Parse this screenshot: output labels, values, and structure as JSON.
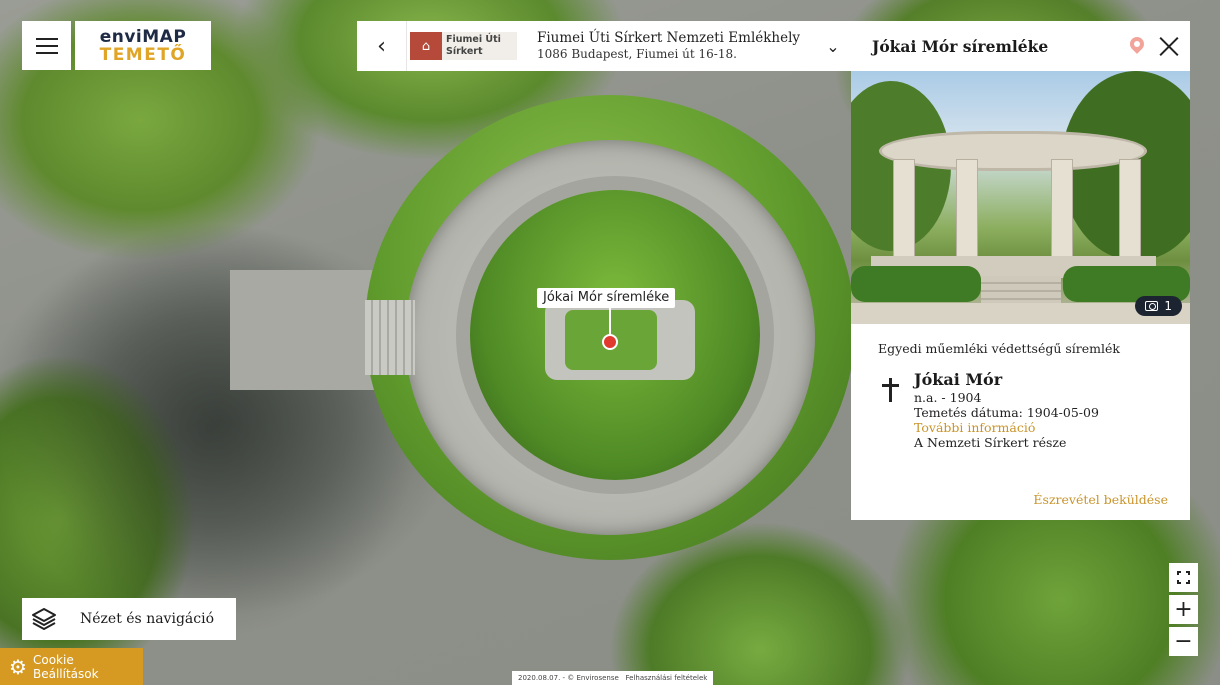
{
  "app": {
    "logo_top": "enviMAP",
    "logo_bottom": "TEMETŐ"
  },
  "cemetery": {
    "logo_line1": "Fiumei Úti",
    "logo_line2": "Sírkert",
    "name": "Fiumei Úti Sírkert Nemzeti Emlékhely",
    "address": "1086 Budapest, Fiumei út 16-18."
  },
  "map": {
    "marker_label": "Jókai Mór síremléke",
    "attribution": "2020.08.07. - © Envirosense",
    "terms_link": "Felhasználási feltételek"
  },
  "panel": {
    "title": "Jókai Mór síremléke",
    "photo_count": "1",
    "protection": "Egyedi műemléki védettségű síremlék",
    "person": {
      "name": "Jókai Mór",
      "dates": "n.a. - 1904",
      "burial": "Temetés dátuma: 1904-05-09",
      "more_info": "További információ",
      "note": "A Nemzeti Sírkert része"
    },
    "feedback": "Észrevétel beküldése"
  },
  "nav": {
    "view_nav_label": "Nézet és navigáció"
  },
  "cookie": {
    "label": "Cookie Beállítások"
  },
  "controls": {
    "zoom_in": "+",
    "zoom_out": "−"
  },
  "colors": {
    "accent": "#d69a22",
    "link": "#c9942a",
    "marker": "#e03a2f"
  }
}
